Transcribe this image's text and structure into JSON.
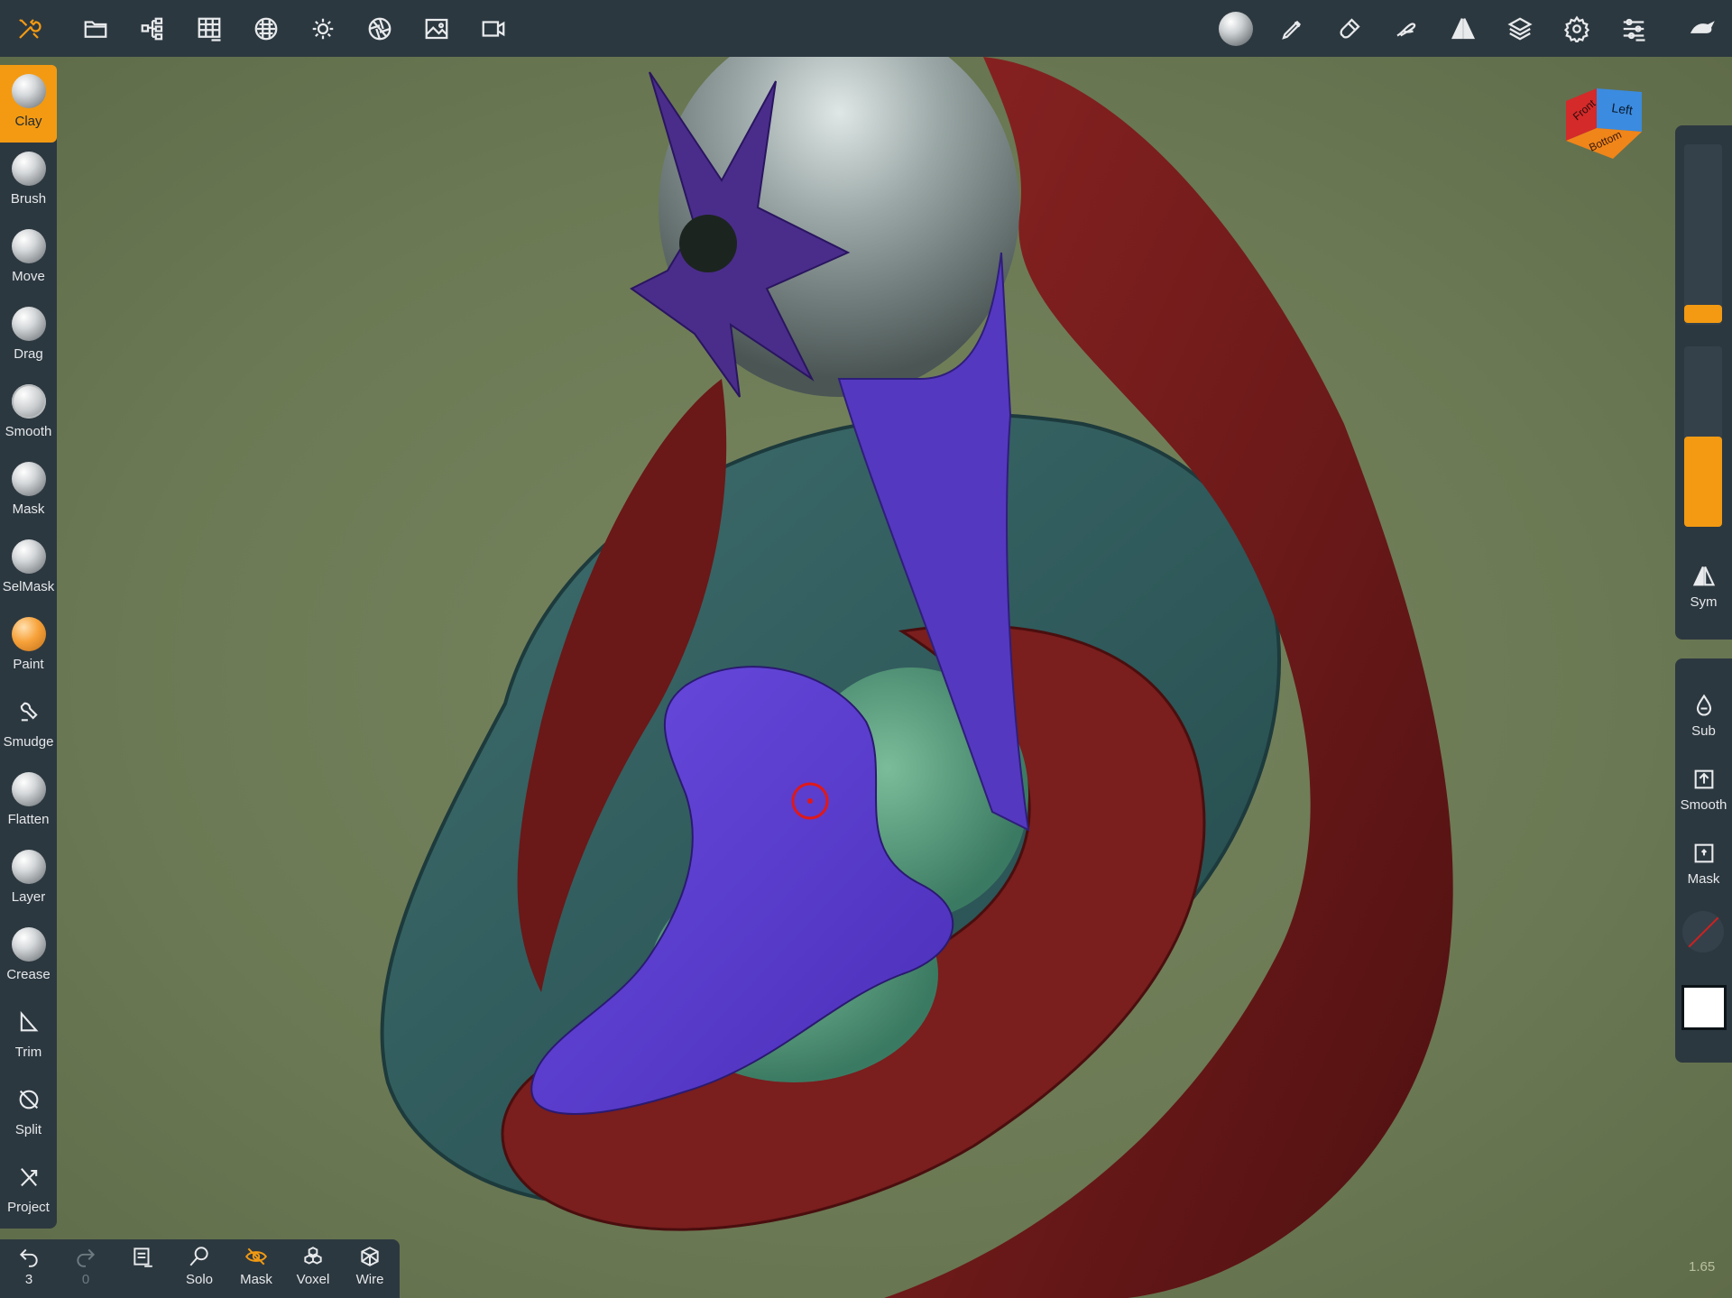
{
  "toolbar_top": {
    "left_icons": [
      "tools-icon",
      "folder-icon",
      "scene-tree-icon",
      "grid-icon",
      "material-sphere-icon",
      "light-icon",
      "camera-aperture-icon",
      "image-icon",
      "video-icon"
    ],
    "right_icons": [
      "matcap-sphere-icon",
      "pencil-icon",
      "brush-icon",
      "stroke-icon",
      "symmetry-icon",
      "layers-icon",
      "settings-icon",
      "sliders-icon",
      "interface-icon"
    ]
  },
  "tools": [
    {
      "label": "Clay",
      "active": true,
      "kind": "ball"
    },
    {
      "label": "Brush",
      "kind": "ball"
    },
    {
      "label": "Move",
      "kind": "ball"
    },
    {
      "label": "Drag",
      "kind": "ball"
    },
    {
      "label": "Smooth",
      "kind": "rough"
    },
    {
      "label": "Mask",
      "kind": "ball"
    },
    {
      "label": "SelMask",
      "kind": "ball"
    },
    {
      "label": "Paint",
      "kind": "paint"
    },
    {
      "label": "Smudge",
      "kind": "line"
    },
    {
      "label": "Flatten",
      "kind": "ball"
    },
    {
      "label": "Layer",
      "kind": "ball"
    },
    {
      "label": "Crease",
      "kind": "ball"
    },
    {
      "label": "Trim",
      "kind": "line"
    },
    {
      "label": "Split",
      "kind": "line"
    },
    {
      "label": "Project",
      "kind": "line"
    }
  ],
  "bottom": {
    "undo_count": "3",
    "redo_count": "0",
    "solo": "Solo",
    "mask": "Mask",
    "voxel": "Voxel",
    "wire": "Wire"
  },
  "right": {
    "sym": "Sym",
    "sub": "Sub",
    "smooth": "Smooth",
    "mask": "Mask",
    "slider1_level": 0.0,
    "slider2_level": 0.5
  },
  "navcube": {
    "front": "Front",
    "left": "Left",
    "bottom": "Bottom"
  },
  "version": "1.65",
  "colors": {
    "accent": "#f39a12",
    "panel": "#2c3840",
    "background": "#6e7b58"
  }
}
